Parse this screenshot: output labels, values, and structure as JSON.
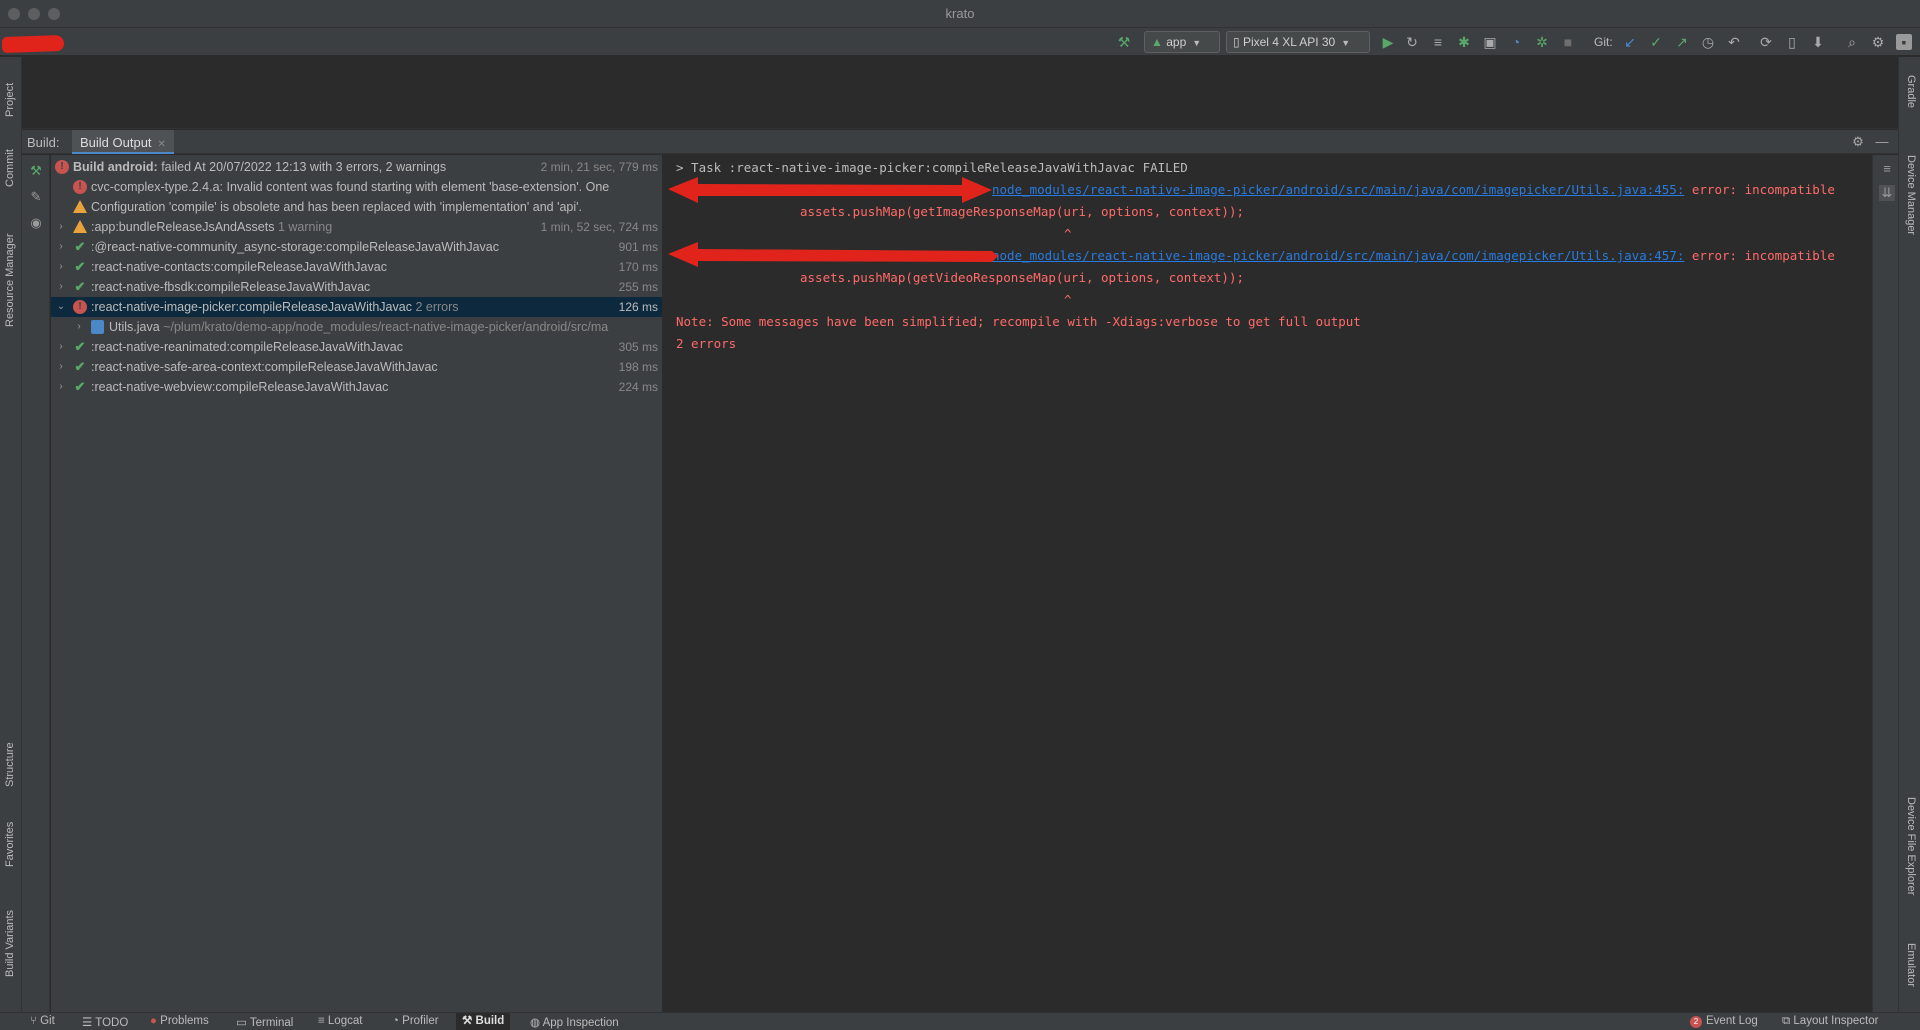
{
  "window": {
    "title": "krato"
  },
  "toolbar": {
    "config_combo": "app",
    "device_combo": "Pixel 4 XL API 30",
    "git_label": "Git:"
  },
  "left_strip": [
    "Project",
    "Commit",
    "Resource Manager",
    "Structure",
    "Favorites",
    "Build Variants"
  ],
  "right_strip": [
    "Gradle",
    "Device Manager",
    "Device File Explorer",
    "Emulator"
  ],
  "build": {
    "label": "Build:",
    "tab": "Build Output",
    "tree": [
      {
        "kind": "root",
        "icon": "error",
        "expanded": true,
        "bold": "Build android:",
        "text": " failed At 20/07/2022 12:13 with 3 errors, 2 warnings",
        "duration": "2 min, 21 sec, 779 ms"
      },
      {
        "kind": "msg",
        "icon": "error",
        "text": "cvc-complex-type.2.4.a: Invalid content was found starting with element 'base-extension'. One",
        "duration": ""
      },
      {
        "kind": "msg",
        "icon": "warning",
        "text": "Configuration 'compile' is obsolete and has been replaced with 'implementation' and 'api'.",
        "duration": ""
      },
      {
        "kind": "task",
        "icon": "warning",
        "text": ":app:bundleReleaseJsAndAssets",
        "note": "1 warning",
        "duration": "1 min, 52 sec, 724 ms"
      },
      {
        "kind": "task",
        "icon": "ok",
        "text": ":@react-native-community_async-storage:compileReleaseJavaWithJavac",
        "duration": "901 ms"
      },
      {
        "kind": "task",
        "icon": "ok",
        "text": ":react-native-contacts:compileReleaseJavaWithJavac",
        "duration": "170 ms"
      },
      {
        "kind": "task",
        "icon": "ok",
        "text": ":react-native-fbsdk:compileReleaseJavaWithJavac",
        "duration": "255 ms"
      },
      {
        "kind": "task",
        "icon": "error",
        "expanded": true,
        "selected": true,
        "text": ":react-native-image-picker:compileReleaseJavaWithJavac",
        "note": "2 errors",
        "duration": "126 ms"
      },
      {
        "kind": "file",
        "icon": "file",
        "text": "Utils.java",
        "note": "~/plum/krato/demo-app/node_modules/react-native-image-picker/android/src/ma",
        "duration": ""
      },
      {
        "kind": "task",
        "icon": "ok",
        "text": ":react-native-reanimated:compileReleaseJavaWithJavac",
        "duration": "305 ms"
      },
      {
        "kind": "task",
        "icon": "ok",
        "text": ":react-native-safe-area-context:compileReleaseJavaWithJavac",
        "duration": "198 ms"
      },
      {
        "kind": "task",
        "icon": "ok",
        "text": ":react-native-webview:compileReleaseJavaWithJavac",
        "duration": "224 ms"
      }
    ]
  },
  "console": {
    "task_line": "> Task :react-native-image-picker:compileReleaseJavaWithJavac FAILED",
    "err1_link": "node_modules/react-native-image-picker/android/src/main/java/com/imagepicker/Utils.java:455:",
    "err1_msg": " error: incompatible",
    "err1_code": "assets.pushMap(getImageResponseMap(uri, options, context));",
    "err1_caret": "^",
    "err2_link": "node_modules/react-native-image-picker/android/src/main/java/com/imagepicker/Utils.java:457:",
    "err2_msg": " error: incompatible",
    "err2_code": "assets.pushMap(getVideoResponseMap(uri, options, context));",
    "err2_caret": "^",
    "note": "Note: Some messages have been simplified; recompile with -Xdiags:verbose to get full output",
    "summary": "2 errors"
  },
  "bottom_bar": {
    "left": [
      "Git",
      "TODO",
      "Problems",
      "Terminal",
      "Logcat",
      "Profiler",
      "Build",
      "App Inspection"
    ],
    "event_log_count": "2",
    "event_log": "Event Log",
    "layout_inspector": "Layout Inspector"
  },
  "colors": {
    "error": "#c75450",
    "ok": "#59a869",
    "warning": "#e8a33d",
    "link": "#287bde",
    "console_error": "#ff6b68",
    "annotation": "#e0241b"
  }
}
